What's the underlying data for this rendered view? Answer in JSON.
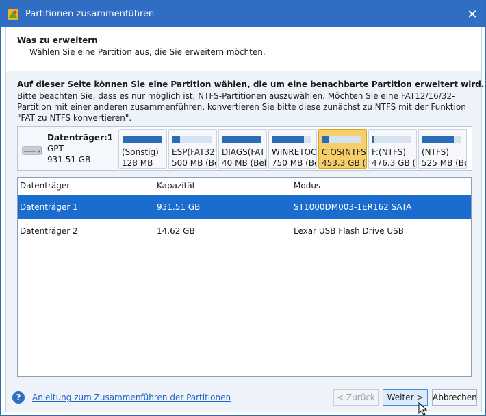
{
  "window": {
    "title": "Partitionen zusammenführen"
  },
  "header": {
    "title": "Was zu erweitern",
    "subtitle": "Wählen Sie eine Partition aus, die Sie erweitern möchten."
  },
  "intro": {
    "bold": "Auf dieser Seite können Sie eine Partition wählen, die um eine benachbarte Partition erweitert wird.",
    "note": "Bitte beachten Sie, dass es nur möglich ist, NTFS-Partitionen auszuwählen. Möchten Sie eine FAT12/16/32-Partition mit einer anderen zusammenführen, konvertieren Sie bitte diese zunächst zu NTFS mit der Funktion \"FAT zu NTFS konvertieren\"."
  },
  "disk": {
    "name": "Datenträger:1",
    "type": "GPT",
    "size": "931.51 GB",
    "icon": "hard-drive-icon",
    "partitions": [
      {
        "label": "(Sonstig)",
        "size": "128 MB",
        "fill": 1.0,
        "selected": false
      },
      {
        "label": "ESP(FAT32)",
        "size": "500 MB (Be",
        "fill": 0.2,
        "selected": false
      },
      {
        "label": "DIAGS(FAT",
        "size": "40 MB (Bel",
        "fill": 1.0,
        "selected": false
      },
      {
        "label": "WINRETOO",
        "size": "750 MB (Be",
        "fill": 0.8,
        "selected": false
      },
      {
        "label": "C:OS(NTFS",
        "size": "453.3 GB (I",
        "fill": 0.15,
        "selected": true
      },
      {
        "label": "F:(NTFS)",
        "size": "476.3 GB (B",
        "fill": 0.05,
        "selected": false
      },
      {
        "label": "(NTFS)",
        "size": "525 MB (Be",
        "fill": 0.8,
        "selected": false
      }
    ]
  },
  "table": {
    "columns": [
      "Datenträger",
      "Kapazität",
      "Modus"
    ],
    "rows": [
      {
        "disk": "Datenträger 1",
        "capacity": "931.51 GB",
        "mode": "ST1000DM003-1ER162 SATA",
        "selected": true
      },
      {
        "disk": "Datenträger 2",
        "capacity": "14.62 GB",
        "mode": "Lexar USB Flash Drive USB",
        "selected": false
      }
    ]
  },
  "footer": {
    "help_link": "Anleitung zum Zusammenführen der Partitionen",
    "back": "< Zurück",
    "next": "Weiter >",
    "cancel": "Abbrechen"
  },
  "colors": {
    "titlebar": "#2f6ec4",
    "selection": "#1b6ccf",
    "partition_selected": "#f6cf6a",
    "bar": "#2b6cb8"
  }
}
